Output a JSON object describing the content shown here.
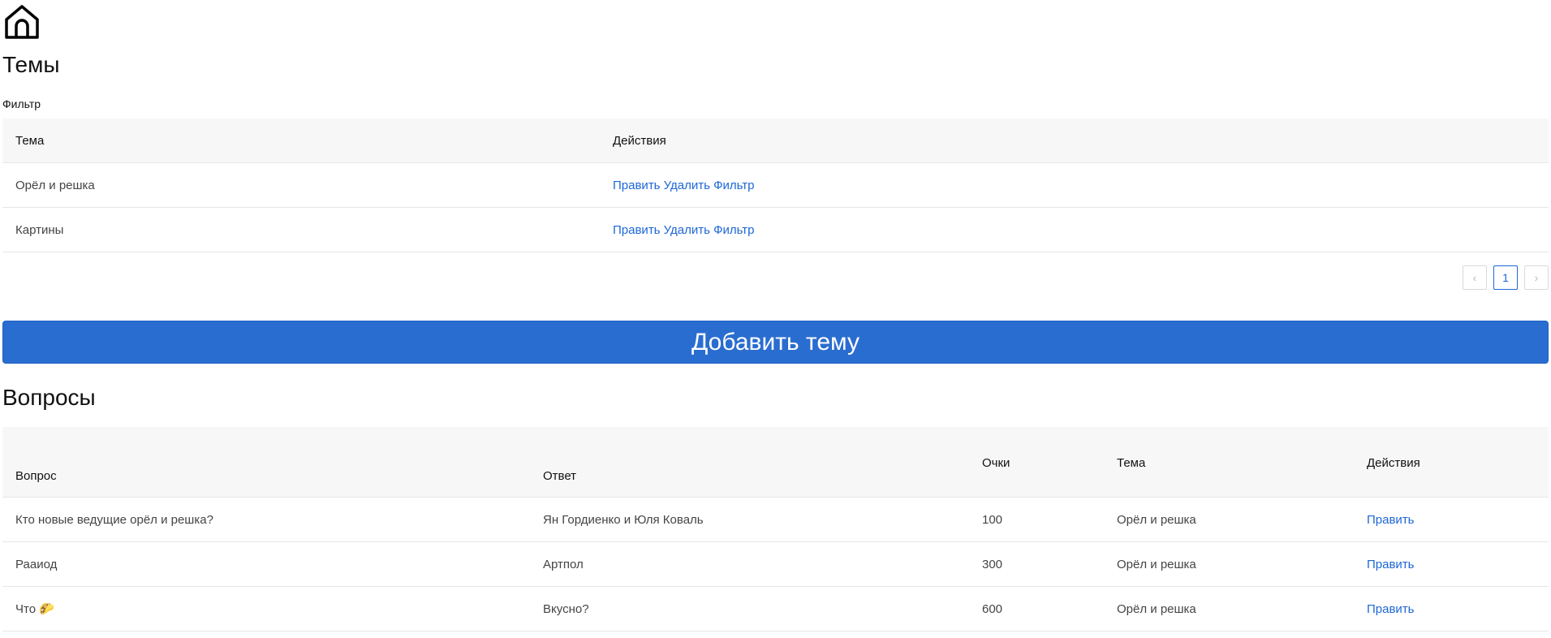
{
  "topics": {
    "title": "Темы",
    "filter_label": "Фильтр",
    "columns": {
      "topic": "Тема",
      "actions": "Действия"
    },
    "rows": [
      {
        "topic": "Орёл и решка",
        "edit": "Править",
        "delete": "Удалить",
        "filter": "Фильтр"
      },
      {
        "topic": "Картины",
        "edit": "Править",
        "delete": "Удалить",
        "filter": "Фильтр"
      }
    ],
    "pagination": {
      "prev": "‹",
      "current": "1",
      "next": "›"
    },
    "add_button": "Добавить тему"
  },
  "questions": {
    "title": "Вопросы",
    "columns": {
      "question": "Вопрос",
      "answer": "Ответ",
      "points": "Очки",
      "topic": "Тема",
      "actions": "Действия"
    },
    "rows": [
      {
        "question": "Кто новые ведущие орёл и решка?",
        "answer": "Ян Гордиенко и Юля Коваль",
        "points": "100",
        "topic": "Орёл и решка",
        "action": "Править"
      },
      {
        "question": "Рааиод",
        "answer": "Артпол",
        "points": "300",
        "topic": "Орёл и решка",
        "action": "Править"
      },
      {
        "question": "Что 🌮",
        "answer": "Вкусно?",
        "points": "600",
        "topic": "Орёл и решка",
        "action": "Править"
      }
    ]
  },
  "icons": {
    "home": "home-icon"
  },
  "colors": {
    "accent": "#2a6dd0",
    "link": "#1d67d6",
    "header_bg": "#f7f7f7"
  }
}
